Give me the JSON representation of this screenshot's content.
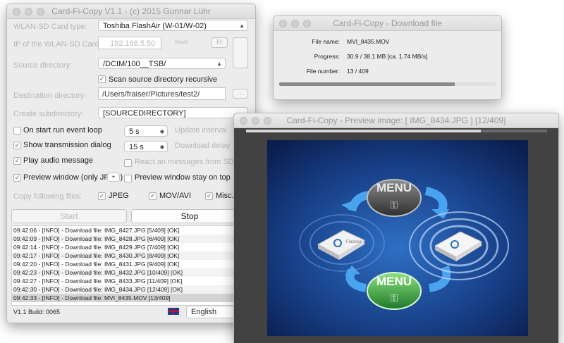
{
  "main_window": {
    "title": "Card-Fi-Copy V1.1 - (c) 2015 Gunnar Lühr",
    "wlan_card_type_label": "WLAN-SD Card type:",
    "wlan_card_type_value": "Toshiba FlashAir (W-01/W-02)",
    "ip_label": "IP of the WLAN-SD Card:",
    "ip_value": "192.168.5.50",
    "ip_hint": "(local)",
    "h_button": "H",
    "source_dir_label": "Source directory:",
    "source_dir_value": "/DCIM/100__TSB/",
    "scan_recursive_label": "Scan source directory recursive",
    "dest_dir_label": "Destination directory:",
    "dest_dir_value": "/Users/fraiser/Pictures/test2/",
    "browse_button": "...",
    "create_subdir_label": "Create subdirectory:",
    "create_subdir_value": "[SOURCEDIRECTORY]",
    "on_start_label": "On start run event loop",
    "update_interval_value": "5 s",
    "update_interval_label": "Update interval",
    "show_transmission_label": "Show transmission dialog",
    "download_delay_value": "15 s",
    "download_delay_label": "Download delay",
    "play_audio_label": "Play audio message",
    "react_label": "React an messages from SD-Ca",
    "preview_window_label": "Preview window (only JPEG)",
    "preview_plus": "+",
    "preview_stay_label": "Preview window stay on top",
    "copy_files_label": "Copy following files:",
    "jpeg_label": "JPEG",
    "movavi_label": "MOV/AVI",
    "misc_label": "Misc.",
    "start_button": "Start",
    "stop_button": "Stop",
    "log": [
      "09:42:06 - [INFO]   - Download file: IMG_8427.JPG [5/409] [OK]",
      "09:42:09 - [INFO]   - Download file: IMG_8428.JPG [6/409] [OK]",
      "09:42:14 - [INFO]   - Download file: IMG_8429.JPG [7/409] [OK]",
      "09:42:17 - [INFO]   - Download file: IMG_8430.JPG [8/409] [OK]",
      "09:42:20 - [INFO]   - Download file: IMG_8431.JPG [9/409] [OK]",
      "09:42:23 - [INFO]   - Download file: IMG_8432.JPG [10/409] [OK]",
      "09:42:27 - [INFO]   - Download file: IMG_8433.JPG [11/409] [OK]",
      "09:42:30 - [INFO]   - Download file: IMG_8434.JPG [12/409] [OK]",
      "09:42:33 - [INFO]   - Download file: MVI_8435.MOV [13/409]"
    ],
    "build": "V1.1 Build: 0065",
    "language": "English"
  },
  "download_window": {
    "title": "Card-Fi-Copy - Download file",
    "file_name_label": "File name:",
    "file_name_value": "MVI_8435.MOV",
    "progress_label": "Progress:",
    "progress_value": "30.9 / 38.1 MB [ca. 1.74 MB/s]",
    "file_number_label": "File number:",
    "file_number_value": "13 / 409",
    "progress_fraction": 0.81
  },
  "preview_window": {
    "title": "Card-Fi-Copy - Preview image: [ IMG_8434.JPG ] [12/409]",
    "progress_fraction": 0.78,
    "menu_top": "MENU",
    "menu_bottom": "MENU",
    "card_brand": "FlashAir"
  }
}
